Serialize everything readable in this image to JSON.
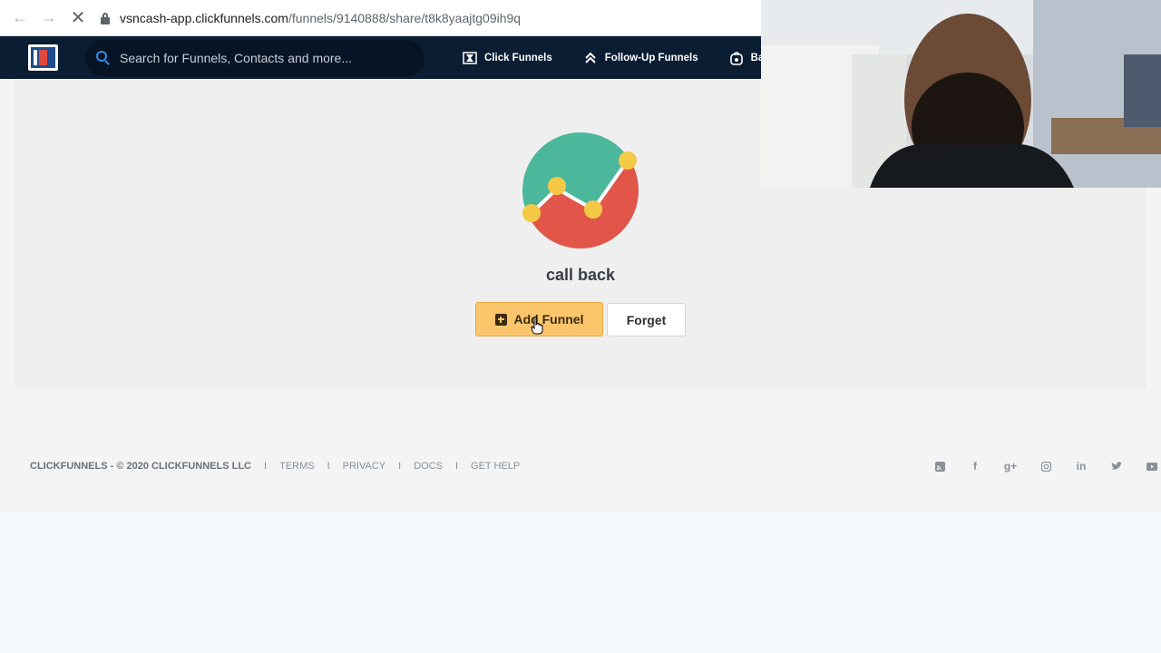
{
  "browser": {
    "url_host": "vsncash-app.clickfunnels.com",
    "url_path": "/funnels/9140888/share/t8k8yaajtg09ih9q"
  },
  "header": {
    "search_placeholder": "Search for Funnels, Contacts and more...",
    "nav": [
      {
        "label": "Click Funnels",
        "icon": "funnel-icon"
      },
      {
        "label": "Follow-Up Funnels",
        "icon": "double-chevron-up-icon"
      },
      {
        "label": "Bac",
        "icon": "backpack-icon"
      }
    ]
  },
  "main": {
    "funnel_name": "call back",
    "add_button": "Add Funnel",
    "forget_button": "Forget",
    "colors": {
      "teal": "#4bb79b",
      "red": "#e2564a",
      "yellow": "#f4c946"
    }
  },
  "footer": {
    "copyright": "CLICKFUNNELS - © 2020 CLICKFUNNELS LLC",
    "links": [
      "TERMS",
      "PRIVACY",
      "DOCS",
      "GET HELP"
    ],
    "social": [
      "rss-icon",
      "facebook-icon",
      "google-plus-icon",
      "instagram-icon",
      "linkedin-icon",
      "twitter-icon",
      "youtube-icon"
    ]
  }
}
